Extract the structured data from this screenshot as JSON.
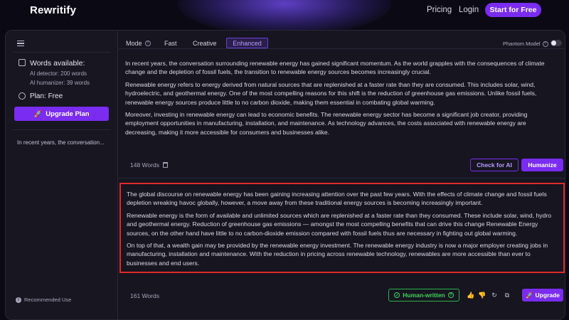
{
  "header": {
    "brand": "Rewritify",
    "pricing_label": "Pricing",
    "login_label": "Login",
    "start_label": "Start for Free"
  },
  "sidebar": {
    "words_available_label": "Words available:",
    "ai_detector": "AI detector: 200 words",
    "ai_humanizer": "AI humanizer: 39 words",
    "plan_label": "Plan: Free",
    "upgrade_plan_label": "Upgrade Plan",
    "history": [
      "In recent years, the conversation..."
    ],
    "recommended_use_label": "Recommended Use"
  },
  "modebar": {
    "mode_label": "Mode",
    "tabs": [
      {
        "label": "Fast",
        "active": false
      },
      {
        "label": "Creative",
        "active": false
      },
      {
        "label": "Enhanced",
        "active": true
      }
    ],
    "phantom_label": "Phantom Model",
    "phantom_enabled": false
  },
  "input": {
    "paragraphs": [
      "In recent years, the conversation surrounding renewable energy has gained significant momentum. As the world grapples with the consequences of climate change and the depletion of fossil fuels, the transition to renewable energy sources becomes increasingly crucial.",
      "Renewable energy refers to energy derived from natural sources that are replenished at a faster rate than they are consumed. This includes solar, wind, hydroelectric, and geothermal energy. One of the most compelling reasons for this shift is the reduction of greenhouse gas emissions. Unlike fossil fuels, renewable energy sources produce little to no carbon dioxide, making them essential in combating global warming.",
      "Moreover, investing in renewable energy can lead to economic benefits. The renewable energy sector has become a significant job creator, providing employment opportunities in manufacturing, installation, and maintenance. As technology advances, the costs associated with renewable energy are decreasing, making it more accessible for consumers and businesses alike."
    ],
    "word_count": "148 Words",
    "check_label": "Check for AI",
    "humanize_label": "Humanize"
  },
  "output": {
    "paragraphs": [
      "The global discourse on renewable energy has been gaining increasing attention over the past few years. With the effects of climate change and fossil fuels depletion wreaking havoc globally, however, a move away from these traditional energy sources is becoming increasingly important.",
      "Renewable energy is the form of available and unlimited sources which are replenished at a faster rate than they consumed. These include solar, wind, hydro and geothermal energy. Reduction of greenhouse gas emissions — amongst the most compelling benefits that can drive this change Renewable Energy sources, on the other hand have little to no carbon-dioxide emission compared with fossil fuels thus are necessary in fighting out global warming.",
      "On top of that, a wealth gain may be provided by the renewable energy investment. The renewable energy industry is now a major employer creating jobs in manufacturing, installation and maintenance. With the reduction in pricing across renewable technology, renewables are more accessible than ever to businesses and end users."
    ],
    "word_count": "161 Words",
    "human_badge": "Human-written",
    "upgrade_label": "Upgrade"
  },
  "colors": {
    "accent": "#7a2cf0",
    "highlight_border": "#e02a2a",
    "success": "#3ed45c"
  }
}
